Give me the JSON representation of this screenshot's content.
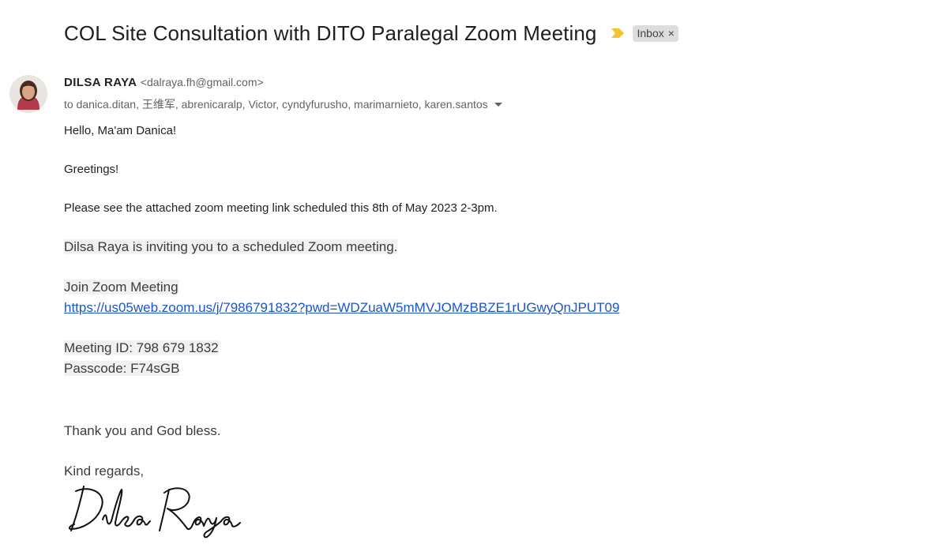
{
  "email": {
    "subject": "COL Site Consultation with DITO Paralegal Zoom Meeting",
    "label": "Inbox",
    "label_remove": "×",
    "sender_name": "DILSA RAYA",
    "sender_email": "<dalraya.fh@gmail.com>",
    "recipients": "to danica.ditan, 王维军, abrenicaralp, Victor, cyndyfurusho, marimarnieto, karen.santos",
    "body": {
      "greeting": "Hello, Ma'am Danica!",
      "greetings": "Greetings!",
      "intro": "Please see the attached zoom meeting link scheduled this 8th of May 2023 2-3pm.",
      "invite": "Dilsa Raya is inviting you to a scheduled Zoom meeting.",
      "join_label": "Join Zoom Meeting",
      "join_link": "https://us05web.zoom.us/j/7986791832?pwd=WDZuaW5mMVJOMzBBZE1rUGwyQnJPUT09",
      "meeting_id": "Meeting ID: 798 679 1832",
      "passcode": "Passcode: F74sGB",
      "thanks": "Thank you and God bless.",
      "regards": "Kind regards,"
    },
    "signature_text": "Dilsa Raya"
  },
  "colors": {
    "importance_marker": "#f4c430",
    "link": "#1a56c9",
    "highlight": "#f1f1f1"
  },
  "icons": {
    "importance": "importance-marker-icon",
    "caret": "chevron-down-icon"
  }
}
